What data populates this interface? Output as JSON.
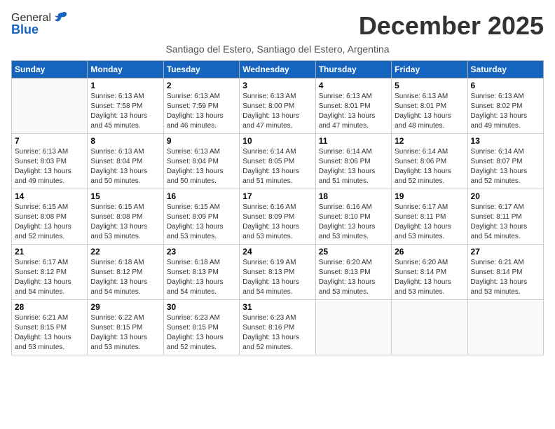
{
  "logo": {
    "general": "General",
    "blue": "Blue"
  },
  "title": "December 2025",
  "subtitle": "Santiago del Estero, Santiago del Estero, Argentina",
  "weekdays": [
    "Sunday",
    "Monday",
    "Tuesday",
    "Wednesday",
    "Thursday",
    "Friday",
    "Saturday"
  ],
  "weeks": [
    [
      {
        "day": "",
        "info": ""
      },
      {
        "day": "1",
        "info": "Sunrise: 6:13 AM\nSunset: 7:58 PM\nDaylight: 13 hours\nand 45 minutes."
      },
      {
        "day": "2",
        "info": "Sunrise: 6:13 AM\nSunset: 7:59 PM\nDaylight: 13 hours\nand 46 minutes."
      },
      {
        "day": "3",
        "info": "Sunrise: 6:13 AM\nSunset: 8:00 PM\nDaylight: 13 hours\nand 47 minutes."
      },
      {
        "day": "4",
        "info": "Sunrise: 6:13 AM\nSunset: 8:01 PM\nDaylight: 13 hours\nand 47 minutes."
      },
      {
        "day": "5",
        "info": "Sunrise: 6:13 AM\nSunset: 8:01 PM\nDaylight: 13 hours\nand 48 minutes."
      },
      {
        "day": "6",
        "info": "Sunrise: 6:13 AM\nSunset: 8:02 PM\nDaylight: 13 hours\nand 49 minutes."
      }
    ],
    [
      {
        "day": "7",
        "info": "Sunrise: 6:13 AM\nSunset: 8:03 PM\nDaylight: 13 hours\nand 49 minutes."
      },
      {
        "day": "8",
        "info": "Sunrise: 6:13 AM\nSunset: 8:04 PM\nDaylight: 13 hours\nand 50 minutes."
      },
      {
        "day": "9",
        "info": "Sunrise: 6:13 AM\nSunset: 8:04 PM\nDaylight: 13 hours\nand 50 minutes."
      },
      {
        "day": "10",
        "info": "Sunrise: 6:14 AM\nSunset: 8:05 PM\nDaylight: 13 hours\nand 51 minutes."
      },
      {
        "day": "11",
        "info": "Sunrise: 6:14 AM\nSunset: 8:06 PM\nDaylight: 13 hours\nand 51 minutes."
      },
      {
        "day": "12",
        "info": "Sunrise: 6:14 AM\nSunset: 8:06 PM\nDaylight: 13 hours\nand 52 minutes."
      },
      {
        "day": "13",
        "info": "Sunrise: 6:14 AM\nSunset: 8:07 PM\nDaylight: 13 hours\nand 52 minutes."
      }
    ],
    [
      {
        "day": "14",
        "info": "Sunrise: 6:15 AM\nSunset: 8:08 PM\nDaylight: 13 hours\nand 52 minutes."
      },
      {
        "day": "15",
        "info": "Sunrise: 6:15 AM\nSunset: 8:08 PM\nDaylight: 13 hours\nand 53 minutes."
      },
      {
        "day": "16",
        "info": "Sunrise: 6:15 AM\nSunset: 8:09 PM\nDaylight: 13 hours\nand 53 minutes."
      },
      {
        "day": "17",
        "info": "Sunrise: 6:16 AM\nSunset: 8:09 PM\nDaylight: 13 hours\nand 53 minutes."
      },
      {
        "day": "18",
        "info": "Sunrise: 6:16 AM\nSunset: 8:10 PM\nDaylight: 13 hours\nand 53 minutes."
      },
      {
        "day": "19",
        "info": "Sunrise: 6:17 AM\nSunset: 8:11 PM\nDaylight: 13 hours\nand 53 minutes."
      },
      {
        "day": "20",
        "info": "Sunrise: 6:17 AM\nSunset: 8:11 PM\nDaylight: 13 hours\nand 54 minutes."
      }
    ],
    [
      {
        "day": "21",
        "info": "Sunrise: 6:17 AM\nSunset: 8:12 PM\nDaylight: 13 hours\nand 54 minutes."
      },
      {
        "day": "22",
        "info": "Sunrise: 6:18 AM\nSunset: 8:12 PM\nDaylight: 13 hours\nand 54 minutes."
      },
      {
        "day": "23",
        "info": "Sunrise: 6:18 AM\nSunset: 8:13 PM\nDaylight: 13 hours\nand 54 minutes."
      },
      {
        "day": "24",
        "info": "Sunrise: 6:19 AM\nSunset: 8:13 PM\nDaylight: 13 hours\nand 54 minutes."
      },
      {
        "day": "25",
        "info": "Sunrise: 6:20 AM\nSunset: 8:13 PM\nDaylight: 13 hours\nand 53 minutes."
      },
      {
        "day": "26",
        "info": "Sunrise: 6:20 AM\nSunset: 8:14 PM\nDaylight: 13 hours\nand 53 minutes."
      },
      {
        "day": "27",
        "info": "Sunrise: 6:21 AM\nSunset: 8:14 PM\nDaylight: 13 hours\nand 53 minutes."
      }
    ],
    [
      {
        "day": "28",
        "info": "Sunrise: 6:21 AM\nSunset: 8:15 PM\nDaylight: 13 hours\nand 53 minutes."
      },
      {
        "day": "29",
        "info": "Sunrise: 6:22 AM\nSunset: 8:15 PM\nDaylight: 13 hours\nand 53 minutes."
      },
      {
        "day": "30",
        "info": "Sunrise: 6:23 AM\nSunset: 8:15 PM\nDaylight: 13 hours\nand 52 minutes."
      },
      {
        "day": "31",
        "info": "Sunrise: 6:23 AM\nSunset: 8:16 PM\nDaylight: 13 hours\nand 52 minutes."
      },
      {
        "day": "",
        "info": ""
      },
      {
        "day": "",
        "info": ""
      },
      {
        "day": "",
        "info": ""
      }
    ]
  ]
}
